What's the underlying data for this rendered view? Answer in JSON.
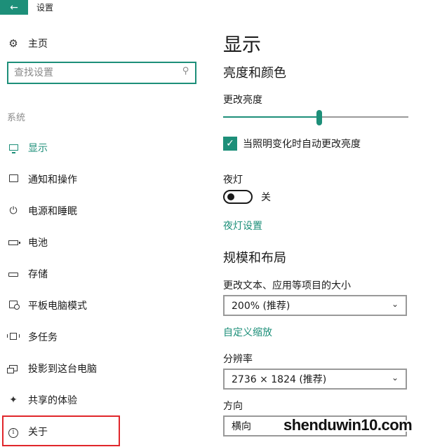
{
  "window": {
    "title": "设置",
    "back_icon": "back-arrow-icon"
  },
  "sidebar": {
    "home": {
      "label": "主页",
      "icon": "gear-icon"
    },
    "search": {
      "placeholder": "查找设置",
      "icon": "search-icon"
    },
    "section_label": "系统",
    "items": [
      {
        "label": "显示",
        "icon": "monitor-icon",
        "active": true
      },
      {
        "label": "通知和操作",
        "icon": "notification-icon"
      },
      {
        "label": "电源和睡眠",
        "icon": "power-icon"
      },
      {
        "label": "电池",
        "icon": "battery-icon"
      },
      {
        "label": "存储",
        "icon": "storage-icon"
      },
      {
        "label": "平板电脑模式",
        "icon": "tablet-mode-icon"
      },
      {
        "label": "多任务",
        "icon": "multitasking-icon"
      },
      {
        "label": "投影到这台电脑",
        "icon": "project-icon"
      },
      {
        "label": "共享的体验",
        "icon": "shared-experience-icon"
      },
      {
        "label": "关于",
        "icon": "info-icon",
        "highlighted": true
      }
    ]
  },
  "main": {
    "title": "显示",
    "brightness_section": {
      "heading": "亮度和颜色",
      "slider_label": "更改亮度",
      "brightness_level": 0.52,
      "auto_checkbox_label": "当照明变化时自动更改亮度",
      "auto_checked": true
    },
    "night_light": {
      "label": "夜灯",
      "toggle_state": "关",
      "settings_link": "夜灯设置"
    },
    "scale_section": {
      "heading": "规模和布局",
      "text_size_label": "更改文本、应用等项目的大小",
      "scale_value": "200% (推荐)",
      "custom_scale_link": "自定义缩放",
      "resolution_label": "分辨率",
      "resolution_value": "2736 × 1824 (推荐)",
      "orientation_label": "方向",
      "orientation_value": "横向"
    }
  },
  "watermark": "shenduwin10.com",
  "colors": {
    "accent": "#1d8f79",
    "highlight_border": "#e0262b"
  }
}
